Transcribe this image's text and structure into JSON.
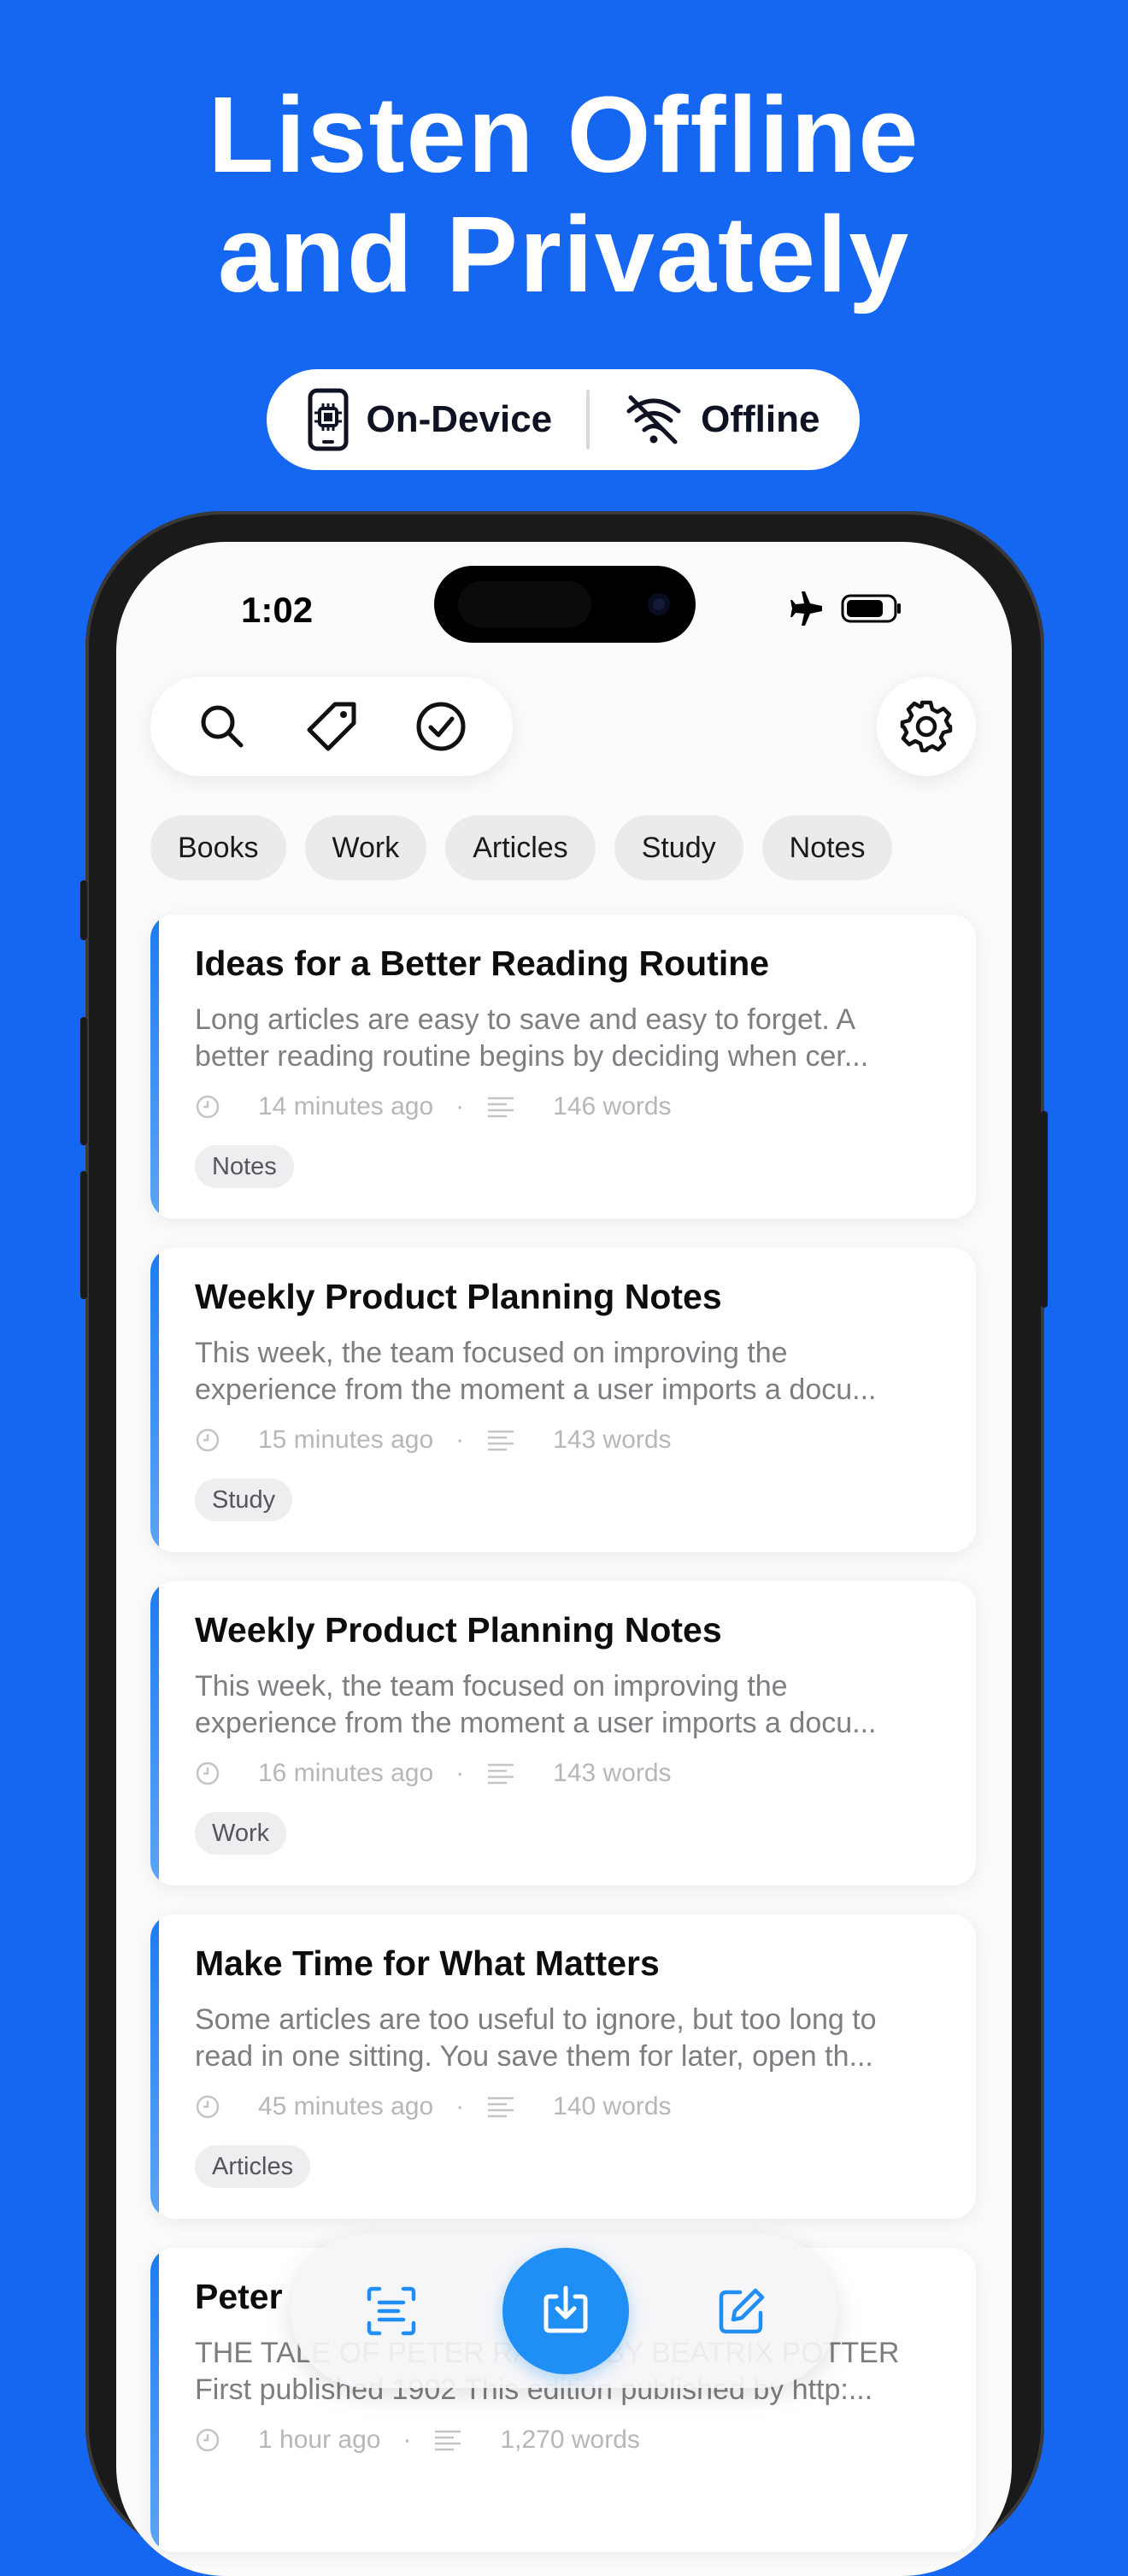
{
  "headline": {
    "line1": "Listen Offline",
    "line2": "and Privately"
  },
  "badge": {
    "left_label": "On-Device",
    "right_label": "Offline",
    "left_icon": "chip-phone-icon",
    "right_icon": "wifi-off-icon"
  },
  "status": {
    "time": "1:02",
    "icons": [
      "airplane-icon",
      "battery-icon"
    ]
  },
  "toolbar": {
    "icons": [
      "search-icon",
      "tag-icon",
      "checkmark-circle-icon",
      "gear-icon"
    ]
  },
  "chips": [
    "Books",
    "Work",
    "Articles",
    "Study",
    "Notes"
  ],
  "cards": [
    {
      "title": "Ideas for a Better Reading Routine",
      "excerpt_line1": "Long articles are easy to save and easy to forget. A",
      "excerpt_line2": "better reading routine begins by deciding when cer...",
      "time": "14 minutes ago",
      "words": "146 words",
      "tag": "Notes"
    },
    {
      "title": "Weekly Product Planning Notes",
      "excerpt_line1": "This week, the team focused on improving the",
      "excerpt_line2": "experience from the moment a user imports a docu...",
      "time": "15 minutes ago",
      "words": "143 words",
      "tag": "Study"
    },
    {
      "title": "Weekly Product Planning Notes",
      "excerpt_line1": "This week, the team focused on improving the",
      "excerpt_line2": "experience from the moment a user imports a docu...",
      "time": "16 minutes ago",
      "words": "143 words",
      "tag": "Work"
    },
    {
      "title": "Make Time for What Matters",
      "excerpt_line1": "Some articles are too useful to ignore, but too long to",
      "excerpt_line2": "read in one sitting. You save them for later, open th...",
      "time": "45 minutes ago",
      "words": "140 words",
      "tag": "Articles"
    },
    {
      "title": "Peter",
      "excerpt_line1": "THE TALE OF PETER RABBIT BY BEATRIX POTTER",
      "excerpt_line2": "First published 1902 This edition published by http:...",
      "time": "1 hour ago",
      "words": "1,270 words",
      "tag": ""
    }
  ],
  "bottom_bar": {
    "icons": [
      "scan-text-icon",
      "import-download-icon",
      "compose-icon"
    ]
  },
  "colors": {
    "background": "#1566f0",
    "accent": "#1f8ef5",
    "card_accent": "#1d7cf2"
  }
}
